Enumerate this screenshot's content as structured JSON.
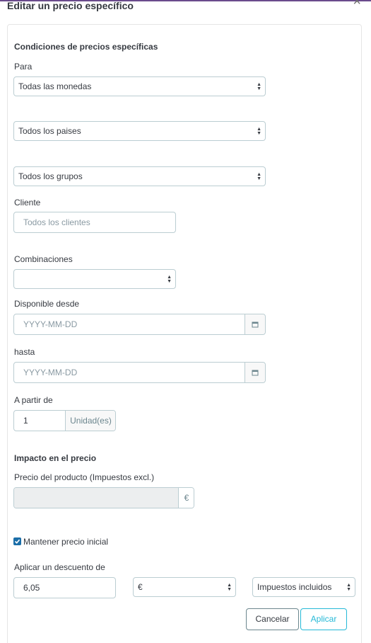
{
  "modal": {
    "title": "Editar un precio específico",
    "close_label": "×"
  },
  "conditions": {
    "heading": "Condiciones de precios específicas",
    "for_label": "Para",
    "currency": "Todas las monedas",
    "country": "Todos los paises",
    "group": "Todos los grupos",
    "customer_label": "Cliente",
    "customer_placeholder": "Todos los clientes",
    "combinations_label": "Combinaciones",
    "combination_value": "",
    "from_label": "Disponible desde",
    "from_placeholder": "YYYY-MM-DD",
    "to_label": "hasta",
    "to_placeholder": "YYYY-MM-DD",
    "starting_at_label": "A partir de",
    "starting_at_value": "1",
    "unit_label": "Unidad(es)"
  },
  "impact": {
    "heading": "Impacto en el precio",
    "price_label": "Precio del producto (Impuestos excl.)",
    "price_value": "",
    "currency_symbol": "€",
    "keep_price_label": "Mantener precio inicial",
    "keep_price_checked": true,
    "discount_label": "Aplicar un descuento de",
    "discount_value": "6,05",
    "discount_type": "€",
    "tax_option": "Impuestos incluidos"
  },
  "actions": {
    "cancel": "Cancelar",
    "apply": "Aplicar"
  },
  "colors": {
    "accent": "#25b9d7",
    "border": "#bbcdd2",
    "checkbox": "#1b6ea8"
  },
  "icons": {
    "calendar": "calendar-icon",
    "select_arrow": "chevron-updown-icon",
    "close": "close-icon",
    "check": "check-icon"
  }
}
